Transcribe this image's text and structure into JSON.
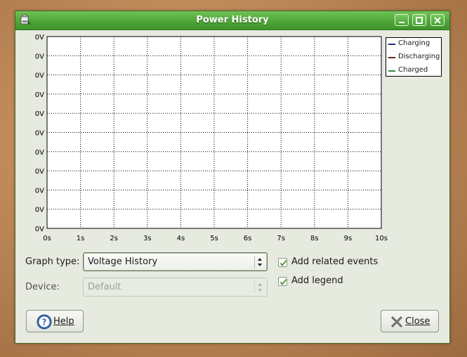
{
  "window": {
    "title": "Power History"
  },
  "legend": [
    {
      "label": "Charging",
      "color": "#1f2c7a"
    },
    {
      "label": "Discharging",
      "color": "#5a2a18"
    },
    {
      "label": "Charged",
      "color": "#2e8b3a"
    }
  ],
  "chart_data": {
    "type": "line",
    "x_ticks": [
      "0s",
      "1s",
      "2s",
      "3s",
      "4s",
      "5s",
      "6s",
      "7s",
      "8s",
      "9s",
      "10s"
    ],
    "y_ticks": [
      "0V",
      "0V",
      "0V",
      "0V",
      "0V",
      "0V",
      "0V",
      "0V",
      "0V",
      "0V",
      "0V"
    ],
    "xlim": [
      0,
      10
    ],
    "ylim": [
      0,
      0
    ],
    "series": [
      {
        "name": "Charging",
        "values": []
      },
      {
        "name": "Discharging",
        "values": []
      },
      {
        "name": "Charged",
        "values": []
      }
    ],
    "grid": true,
    "legend_position": "right"
  },
  "controls": {
    "graph_type_label": "Graph type:",
    "graph_type_value": "Voltage History",
    "device_label": "Device:",
    "device_value": "Default",
    "add_events_label": "Add related events",
    "add_events_checked": true,
    "add_legend_label": "Add legend",
    "add_legend_checked": true
  },
  "buttons": {
    "help": "Help",
    "close": "Close"
  }
}
